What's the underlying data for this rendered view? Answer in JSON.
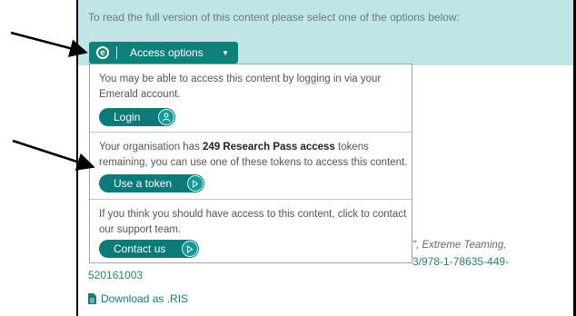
{
  "banner": {
    "text": "To read the full version of this content please select one of the options below:",
    "access_button_label": "Access options",
    "logo_letter": "e"
  },
  "dropdown": {
    "login": {
      "text": "You may be able to access this content by logging in via your Emerald account.",
      "button": "Login"
    },
    "token": {
      "text_before": "Your organisation has ",
      "text_bold": "249 Research Pass access",
      "text_after": " tokens remaining, you can use one of these tokens to access this content.",
      "button": "Use a token"
    },
    "contact": {
      "text": "If you think you should have access to this content, click to contact our support team.",
      "button": "Contact us"
    }
  },
  "background": {
    "citation_fragment": "\", Extreme Teaming,",
    "doi_fragment": "3/978-1-78635-449-",
    "doi_line2": "520161003",
    "download_label": "Download as .RIS"
  },
  "colors": {
    "banner_bg": "#bfe6e4",
    "brand_teal": "#10807a",
    "link_teal": "#1a7a7a"
  }
}
